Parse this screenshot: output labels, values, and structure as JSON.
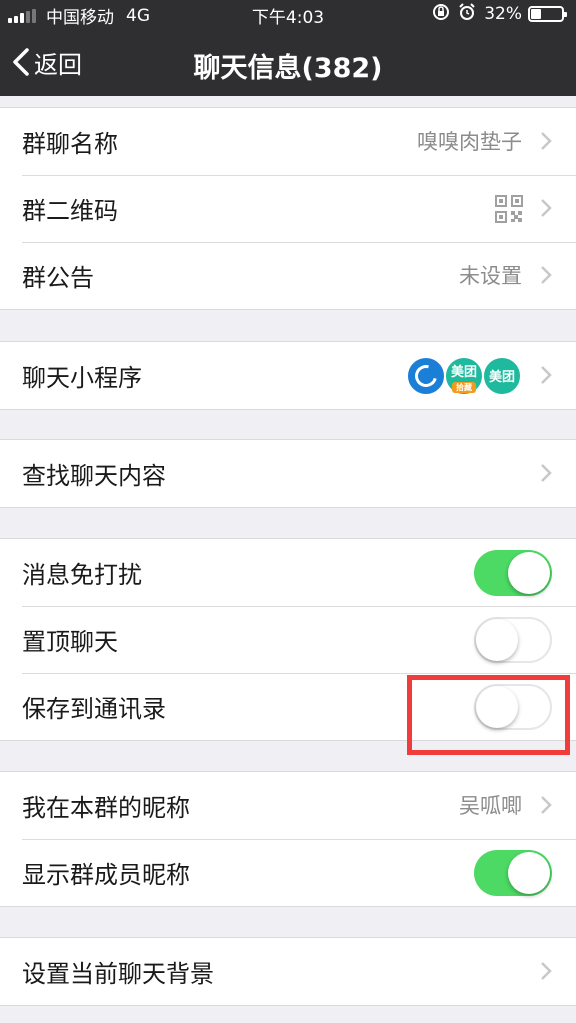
{
  "status_bar": {
    "carrier": "中国移动",
    "network": "4G",
    "time": "下午4:03",
    "battery_text": "32%",
    "battery_level": 0.32
  },
  "nav": {
    "back_label": "返回",
    "title": "聊天信息(382)"
  },
  "group_info": {
    "name_label": "群聊名称",
    "name_value": "嗅嗅肉垫子",
    "qr_label": "群二维码",
    "notice_label": "群公告",
    "notice_value": "未设置"
  },
  "mini_programs": {
    "label": "聊天小程序",
    "apps": [
      {
        "name": ""
      },
      {
        "name": "美团",
        "sub": "拾藏"
      },
      {
        "name": "美团"
      }
    ]
  },
  "search": {
    "label": "查找聊天内容"
  },
  "settings": {
    "mute_label": "消息免打扰",
    "mute_on": true,
    "pin_label": "置顶聊天",
    "pin_on": false,
    "save_label": "保存到通讯录",
    "save_on": false
  },
  "nickname": {
    "my_label": "我在本群的昵称",
    "my_value": "吴呱唧",
    "show_label": "显示群成员昵称",
    "show_on": true
  },
  "background": {
    "label": "设置当前聊天背景"
  },
  "colors": {
    "nav_bg": "#2f2f31",
    "toggle_on": "#4cd964",
    "highlight": "#f13c3c"
  }
}
